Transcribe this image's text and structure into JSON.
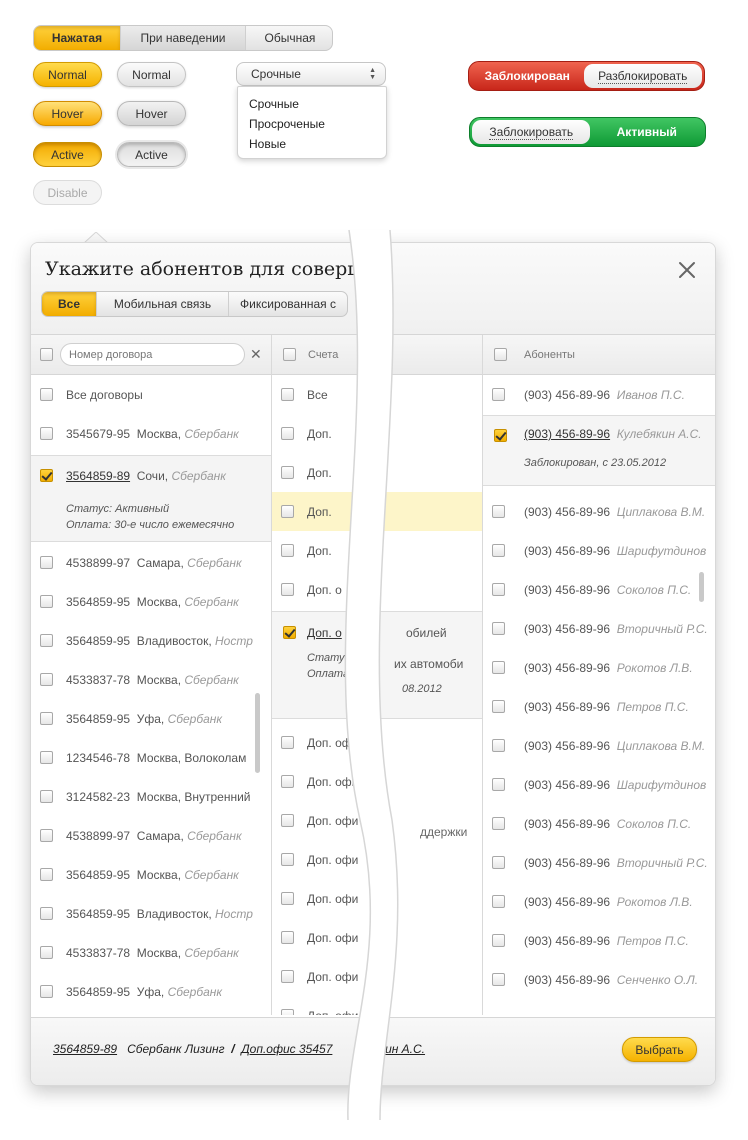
{
  "segmented": [
    "Нажатая",
    "При наведении",
    "Обычная"
  ],
  "buttons": {
    "normal": "Normal",
    "hover": "Hover",
    "active": "Active",
    "disable": "Disable"
  },
  "select": {
    "value": "Срочные",
    "options": [
      "Срочные",
      "Просроченые",
      "Новые"
    ]
  },
  "toggles": {
    "blocked_label": "Заблокирован",
    "unblock_button": "Разблокировать",
    "block_button": "Заблокировать",
    "active_label": "Активный"
  },
  "colors": {
    "accent_yellow": "#f5b200",
    "blocked_red": "#d5301f",
    "active_green": "#1aa845"
  },
  "dialog": {
    "title": "Укажите абонентов для совершен",
    "close_icon": "close-icon",
    "tabs": [
      "Все",
      "Мобильная связь",
      "Фиксированная с"
    ],
    "contracts": {
      "search_placeholder": "Номер договора",
      "all_label": "Все договоры",
      "rows": [
        {
          "num": "3545679-95",
          "city": "Москва,",
          "bank": "Сбербанк"
        },
        {
          "num": "4538899-97",
          "city": "Самара,",
          "bank": "Сбербанк"
        },
        {
          "num": "3564859-95",
          "city": "Москва,",
          "bank": "Сбербанк"
        },
        {
          "num": "3564859-95",
          "city": "Владивосток,",
          "bank": "Ностр"
        },
        {
          "num": "4533837-78",
          "city": "Москва,",
          "bank": "Сбербанк"
        },
        {
          "num": "3564859-95",
          "city": "Уфа,",
          "bank": "Сбербанк"
        },
        {
          "num": "1234546-78",
          "city": "Москва, Волоколам",
          "bank": ""
        },
        {
          "num": "3124582-23",
          "city": "Москва, Внутренний",
          "bank": ""
        },
        {
          "num": "4538899-97",
          "city": "Самара,",
          "bank": "Сбербанк"
        },
        {
          "num": "3564859-95",
          "city": "Москва,",
          "bank": "Сбербанк"
        },
        {
          "num": "3564859-95",
          "city": "Владивосток,",
          "bank": "Ностр"
        },
        {
          "num": "4533837-78",
          "city": "Москва,",
          "bank": "Сбербанк"
        },
        {
          "num": "3564859-95",
          "city": "Уфа,",
          "bank": "Сбербанк"
        }
      ],
      "selected": {
        "num": "3564859-89",
        "city": "Сочи,",
        "bank": "Сбербанк",
        "status": "Статус: Активный",
        "payment": "Оплата: 30-е число ежемесячно"
      }
    },
    "accounts": {
      "header": "Счета",
      "all_label": "Все",
      "office": "Доп.",
      "office_full": "Доп. офи",
      "office_cut": "Доп. о",
      "selected_left": "Доп. о",
      "selected_right": "обилей",
      "detail_status": "Статус",
      "detail_payment": "Оплата:",
      "detail_right1": "их автомоби",
      "detail_right2": "08.2012",
      "support": "ддержки"
    },
    "subscribers": {
      "header": "Абоненты",
      "rows": [
        {
          "phone": "(903) 456-89-96",
          "name": "Иванов П.С."
        },
        {
          "phone": "(903) 456-89-96",
          "name": "Циплакова В.М."
        },
        {
          "phone": "(903) 456-89-96",
          "name": "Шарифутдинов"
        },
        {
          "phone": "(903) 456-89-96",
          "name": "Соколов П.С."
        },
        {
          "phone": "(903) 456-89-96",
          "name": "Вторичный Р.С."
        },
        {
          "phone": "(903) 456-89-96",
          "name": "Рокотов Л.В."
        },
        {
          "phone": "(903) 456-89-96",
          "name": "Петров П.С."
        },
        {
          "phone": "(903) 456-89-96",
          "name": "Циплакова В.М."
        },
        {
          "phone": "(903) 456-89-96",
          "name": "Шарифутдинов"
        },
        {
          "phone": "(903) 456-89-96",
          "name": "Соколов П.С."
        },
        {
          "phone": "(903) 456-89-96",
          "name": "Вторичный Р.С."
        },
        {
          "phone": "(903) 456-89-96",
          "name": "Рокотов Л.В."
        },
        {
          "phone": "(903) 456-89-96",
          "name": "Петров П.С."
        },
        {
          "phone": "(903) 456-89-96",
          "name": "Сенченко О.Л."
        }
      ],
      "selected": {
        "phone": "(903) 456-89-96",
        "name": "Кулебякин А.С.",
        "status": "Заблокирован, с 23.05.2012"
      }
    },
    "footer": {
      "contract": "3564859-89",
      "bank": "Сбербанк Лизинг",
      "separator": "/",
      "office": "Доп.офис 35457",
      "person": "бякин А.С.",
      "select_button": "Выбрать"
    }
  }
}
